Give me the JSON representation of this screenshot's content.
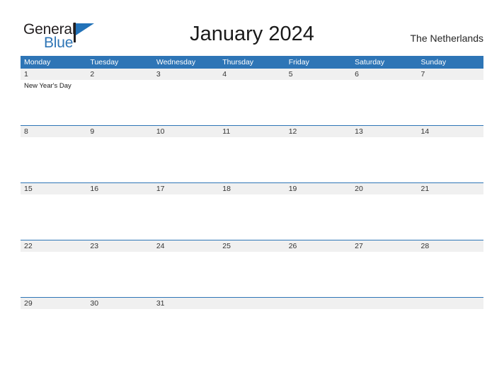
{
  "brand": {
    "name_part1": "General",
    "name_part2": "Blue",
    "triangle_icon": "triangle-logo-mark",
    "color_dark": "#231f20",
    "color_blue": "#2e75b6"
  },
  "header": {
    "title": "January 2024",
    "location": "The Netherlands"
  },
  "calendar": {
    "accent_color": "#2e75b6",
    "date_strip_color": "#f0f0f0",
    "day_headers": [
      "Monday",
      "Tuesday",
      "Wednesday",
      "Thursday",
      "Friday",
      "Saturday",
      "Sunday"
    ],
    "weeks": [
      {
        "days": [
          {
            "date": "1",
            "events": [
              "New Year's Day"
            ]
          },
          {
            "date": "2",
            "events": []
          },
          {
            "date": "3",
            "events": []
          },
          {
            "date": "4",
            "events": []
          },
          {
            "date": "5",
            "events": []
          },
          {
            "date": "6",
            "events": []
          },
          {
            "date": "7",
            "events": []
          }
        ]
      },
      {
        "days": [
          {
            "date": "8",
            "events": []
          },
          {
            "date": "9",
            "events": []
          },
          {
            "date": "10",
            "events": []
          },
          {
            "date": "11",
            "events": []
          },
          {
            "date": "12",
            "events": []
          },
          {
            "date": "13",
            "events": []
          },
          {
            "date": "14",
            "events": []
          }
        ]
      },
      {
        "days": [
          {
            "date": "15",
            "events": []
          },
          {
            "date": "16",
            "events": []
          },
          {
            "date": "17",
            "events": []
          },
          {
            "date": "18",
            "events": []
          },
          {
            "date": "19",
            "events": []
          },
          {
            "date": "20",
            "events": []
          },
          {
            "date": "21",
            "events": []
          }
        ]
      },
      {
        "days": [
          {
            "date": "22",
            "events": []
          },
          {
            "date": "23",
            "events": []
          },
          {
            "date": "24",
            "events": []
          },
          {
            "date": "25",
            "events": []
          },
          {
            "date": "26",
            "events": []
          },
          {
            "date": "27",
            "events": []
          },
          {
            "date": "28",
            "events": []
          }
        ]
      },
      {
        "days": [
          {
            "date": "29",
            "events": []
          },
          {
            "date": "30",
            "events": []
          },
          {
            "date": "31",
            "events": []
          },
          {
            "date": "",
            "events": []
          },
          {
            "date": "",
            "events": []
          },
          {
            "date": "",
            "events": []
          },
          {
            "date": "",
            "events": []
          }
        ]
      }
    ]
  }
}
